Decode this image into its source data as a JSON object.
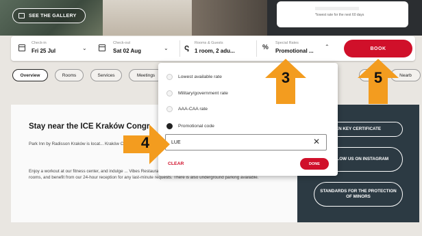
{
  "hero": {
    "gallery_label": "SEE THE GALLERY",
    "price_note": "*lowest rate for the next 60 days"
  },
  "booking": {
    "checkin_caption": "Check-in",
    "checkin_value": "Fri 25 Jul",
    "checkout_caption": "Check-out",
    "checkout_value": "Sat 02 Aug",
    "rooms_caption": "Rooms & Guests",
    "rooms_value": "1 room, 2 adu...",
    "rates_caption": "Special Rates",
    "rates_value": "Promotional ...",
    "book_label": "BOOK"
  },
  "tabs": [
    "Overview",
    "Rooms",
    "Services",
    "Meetings",
    "Re",
    "Nearb"
  ],
  "content": {
    "heading": "Stay near the ICE Kraków Congr",
    "para1": "Park Inn by Radisson Kraków is locat... Kraków Congress Centre. Take a shor... discover Wawel Castle, which dates back to the 13",
    "para2": "Enjoy a workout at our fitness center, and indulge ... Vibes Restaurant & Bar. For events, choose from our five modern function rooms, and benefit from our 24-hour reception for any last-minute requests. There is also underground parking available."
  },
  "panel": {
    "btn1": "EN KEY CERTIFICATE",
    "btn2": "FOLLOW US ON INSTAGRAM",
    "btn3": "STANDARDS FOR THE PROTECTION OF MINORS"
  },
  "dropdown": {
    "options": [
      "Lowest available rate",
      "Military/government rate",
      "AAA-CAA rate",
      "Promotional code"
    ],
    "selected_option": "Promotional code",
    "code_value": "LUE",
    "clear_label": "CLEAR",
    "done_label": "DONE"
  },
  "annotations": {
    "n3": "3",
    "n4": "4",
    "n5": "5",
    "color": "#f39c1f"
  },
  "colors": {
    "accent": "#d0102a",
    "panel": "#2c3a43"
  }
}
